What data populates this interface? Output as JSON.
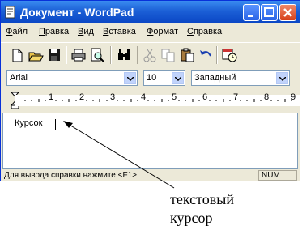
{
  "window": {
    "title": "Документ - WordPad"
  },
  "menu": [
    {
      "label": "Файл",
      "accel": "Ф",
      "rest": "айл"
    },
    {
      "label": "Правка",
      "accel": "П",
      "rest": "равка"
    },
    {
      "label": "Вид",
      "accel": "В",
      "rest": "ид"
    },
    {
      "label": "Вставка",
      "accel": "В",
      "rest": "ставка"
    },
    {
      "label": "Формат",
      "accel": "Ф",
      "rest": "ормат"
    },
    {
      "label": "Справка",
      "accel": "С",
      "rest": "правка"
    }
  ],
  "toolbar": {
    "icons": [
      "new-icon",
      "open-icon",
      "save-icon",
      "print-icon",
      "print-preview-icon",
      "find-icon",
      "cut-icon",
      "copy-icon",
      "paste-icon",
      "undo-icon",
      "insert-datetime-icon"
    ]
  },
  "format": {
    "font": "Arial",
    "size": "10",
    "script": "Западный"
  },
  "ruler": {
    "labels": [
      "1",
      "2",
      "3",
      "4",
      "5",
      "6",
      "7",
      "8",
      "9"
    ]
  },
  "document": {
    "text": "Курсок"
  },
  "status": {
    "help": "Для вывода справки нажмите <F1>",
    "num": "NUM"
  },
  "annotation": {
    "line1": "текстовый",
    "line2": "курсор"
  },
  "colors": {
    "titlebar": "#0a46c4",
    "window_bg": "#ece9d8"
  }
}
